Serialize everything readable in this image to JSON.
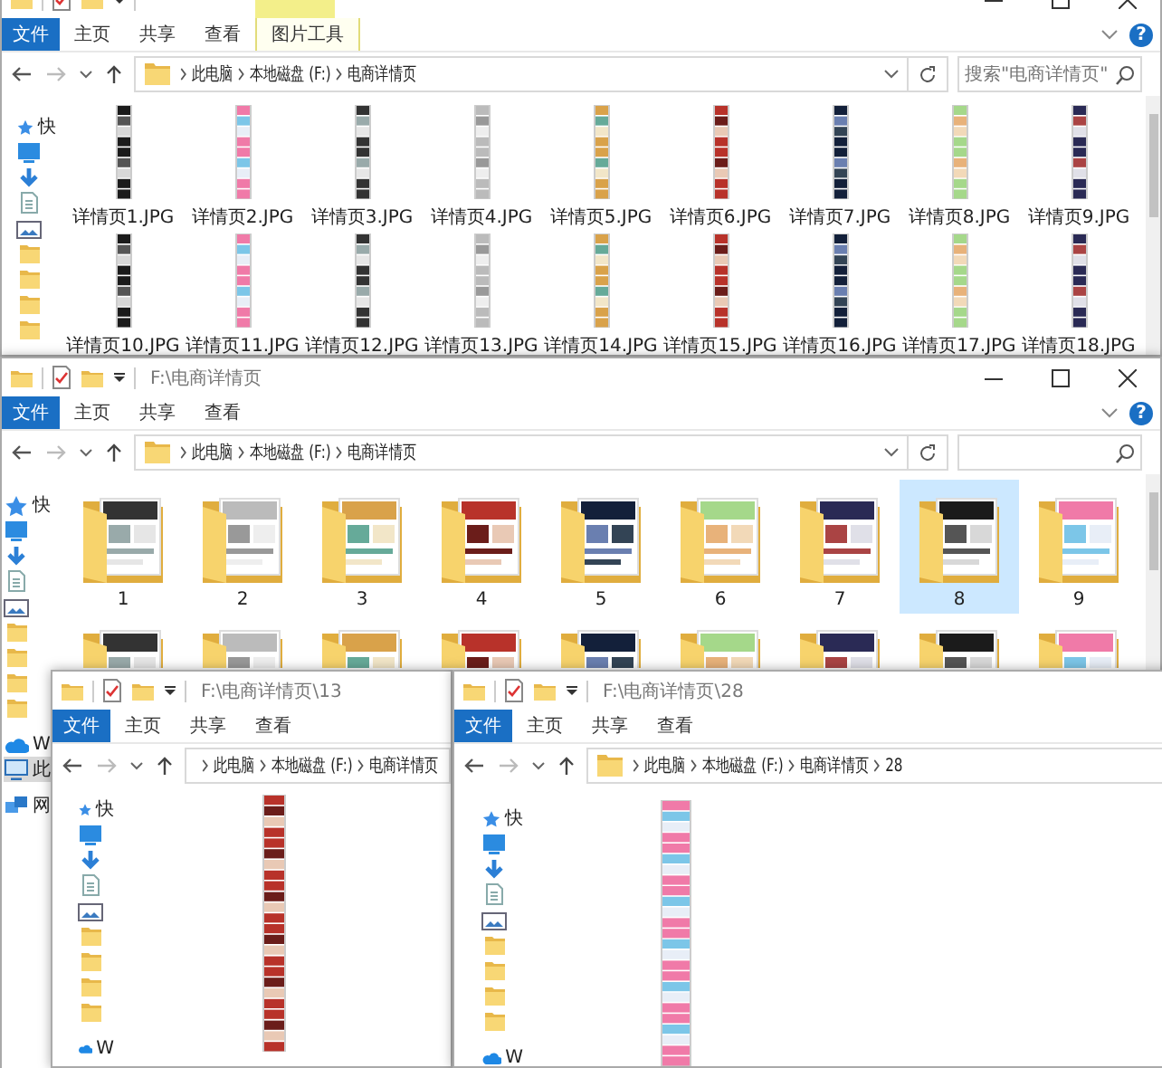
{
  "windows": [
    {
      "context_group": true,
      "ribbon_tabs": [
        {
          "label": "文件",
          "kind": "file"
        },
        {
          "label": "主页",
          "kind": "tab"
        },
        {
          "label": "共享",
          "kind": "tab"
        },
        {
          "label": "查看",
          "kind": "tab"
        },
        {
          "label": "图片工具",
          "kind": "context"
        }
      ],
      "help": "?",
      "breadcrumb": [
        "此电脑",
        "本地磁盘 (F:)",
        "电商详情页"
      ],
      "search": {
        "placeholder": "搜索\"电商详情页\""
      },
      "sidebar": [
        {
          "kind": "quick",
          "label": "快",
          "selected": false
        },
        {
          "kind": "desktop",
          "selected": false
        },
        {
          "kind": "download",
          "selected": false
        },
        {
          "kind": "document",
          "selected": false
        },
        {
          "kind": "picture",
          "selected": false
        },
        {
          "kind": "folder",
          "selected": false
        },
        {
          "kind": "folder",
          "selected": false
        },
        {
          "kind": "folder",
          "selected": false
        },
        {
          "kind": "folder",
          "selected": false
        }
      ],
      "items": [
        {
          "kind": "image",
          "label": "详情页1.JPG",
          "selected": false
        },
        {
          "kind": "image",
          "label": "详情页2.JPG",
          "selected": false
        },
        {
          "kind": "image",
          "label": "详情页3.JPG",
          "selected": false
        },
        {
          "kind": "image",
          "label": "详情页4.JPG",
          "selected": false
        },
        {
          "kind": "image",
          "label": "详情页5.JPG",
          "selected": false
        },
        {
          "kind": "image",
          "label": "详情页6.JPG",
          "selected": false
        },
        {
          "kind": "image",
          "label": "详情页7.JPG",
          "selected": false
        },
        {
          "kind": "image",
          "label": "详情页8.JPG",
          "selected": false
        },
        {
          "kind": "image",
          "label": "详情页9.JPG",
          "selected": false
        },
        {
          "kind": "image",
          "label": "详情页10.JPG",
          "selected": false
        },
        {
          "kind": "image",
          "label": "详情页11.JPG",
          "selected": false
        },
        {
          "kind": "image",
          "label": "详情页12.JPG",
          "selected": false
        },
        {
          "kind": "image",
          "label": "详情页13.JPG",
          "selected": false
        },
        {
          "kind": "image",
          "label": "详情页14.JPG",
          "selected": false
        },
        {
          "kind": "image",
          "label": "详情页15.JPG",
          "selected": false
        },
        {
          "kind": "image",
          "label": "详情页16.JPG",
          "selected": false
        },
        {
          "kind": "image",
          "label": "详情页17.JPG",
          "selected": false
        },
        {
          "kind": "image",
          "label": "详情页18.JPG",
          "selected": false
        }
      ]
    },
    {
      "title": "F:\\电商详情页",
      "ribbon_tabs": [
        {
          "label": "文件",
          "kind": "file"
        },
        {
          "label": "主页",
          "kind": "tab"
        },
        {
          "label": "共享",
          "kind": "tab"
        },
        {
          "label": "查看",
          "kind": "tab"
        }
      ],
      "help": "?",
      "breadcrumb": [
        "此电脑",
        "本地磁盘 (F:)",
        "电商详情页"
      ],
      "sidebar": [
        {
          "kind": "quick",
          "label": "快",
          "selected": false
        },
        {
          "kind": "desktop",
          "selected": false
        },
        {
          "kind": "download",
          "selected": false
        },
        {
          "kind": "document",
          "selected": false
        },
        {
          "kind": "picture",
          "selected": false
        },
        {
          "kind": "folder",
          "selected": false
        },
        {
          "kind": "folder",
          "selected": false
        },
        {
          "kind": "folder",
          "selected": false
        },
        {
          "kind": "folder",
          "selected": false
        },
        {
          "kind": "onedrive",
          "label": "W",
          "selected": false
        },
        {
          "kind": "pc",
          "label": "此",
          "selected": true
        },
        {
          "kind": "network",
          "label": "网",
          "selected": false
        }
      ],
      "items": [
        {
          "kind": "folder",
          "label": "1",
          "selected": false
        },
        {
          "kind": "folder",
          "label": "2",
          "selected": false
        },
        {
          "kind": "folder",
          "label": "3",
          "selected": false
        },
        {
          "kind": "folder",
          "label": "4",
          "selected": false
        },
        {
          "kind": "folder",
          "label": "5",
          "selected": false
        },
        {
          "kind": "folder",
          "label": "6",
          "selected": false
        },
        {
          "kind": "folder",
          "label": "7",
          "selected": false
        },
        {
          "kind": "folder",
          "label": "8",
          "selected": true
        },
        {
          "kind": "folder",
          "label": "9",
          "selected": false
        },
        {
          "kind": "folder",
          "selected": false
        },
        {
          "kind": "folder",
          "selected": false
        },
        {
          "kind": "folder",
          "selected": false
        },
        {
          "kind": "folder",
          "selected": false
        },
        {
          "kind": "folder",
          "selected": false
        },
        {
          "kind": "folder",
          "selected": false
        },
        {
          "kind": "folder",
          "selected": false
        },
        {
          "kind": "folder",
          "selected": false
        },
        {
          "kind": "folder",
          "selected": false
        }
      ]
    },
    {
      "title": "F:\\电商详情页\\13",
      "ribbon_tabs": [
        {
          "label": "文件",
          "kind": "file"
        },
        {
          "label": "主页",
          "kind": "tab"
        },
        {
          "label": "共享",
          "kind": "tab"
        },
        {
          "label": "查看",
          "kind": "tab"
        }
      ],
      "breadcrumb": [
        "此电脑",
        "本地磁盘 (F:)",
        "电商详情页"
      ],
      "sidebar": [
        {
          "kind": "quick",
          "label": "快",
          "selected": false
        },
        {
          "kind": "desktop",
          "selected": false
        },
        {
          "kind": "download",
          "selected": false
        },
        {
          "kind": "document",
          "selected": false
        },
        {
          "kind": "picture",
          "selected": false
        },
        {
          "kind": "folder",
          "selected": false
        },
        {
          "kind": "folder",
          "selected": false
        },
        {
          "kind": "folder",
          "selected": false
        },
        {
          "kind": "folder",
          "selected": false
        },
        {
          "kind": "onedrive",
          "label": "W",
          "selected": false
        }
      ],
      "items": [
        {
          "kind": "image",
          "selected": false
        }
      ]
    },
    {
      "title": "F:\\电商详情页\\28",
      "ribbon_tabs": [
        {
          "label": "文件",
          "kind": "file"
        },
        {
          "label": "主页",
          "kind": "tab"
        },
        {
          "label": "共享",
          "kind": "tab"
        },
        {
          "label": "查看",
          "kind": "tab"
        }
      ],
      "breadcrumb": [
        "此电脑",
        "本地磁盘 (F:)",
        "电商详情页",
        "28"
      ],
      "sidebar": [
        {
          "kind": "quick",
          "label": "快",
          "selected": false
        },
        {
          "kind": "desktop",
          "selected": false
        },
        {
          "kind": "download",
          "selected": false
        },
        {
          "kind": "document",
          "selected": false
        },
        {
          "kind": "picture",
          "selected": false
        },
        {
          "kind": "folder",
          "selected": false
        },
        {
          "kind": "folder",
          "selected": false
        },
        {
          "kind": "folder",
          "selected": false
        },
        {
          "kind": "folder",
          "selected": false
        },
        {
          "kind": "onedrive",
          "label": "W",
          "selected": false
        }
      ],
      "items": [
        {
          "kind": "image",
          "selected": false
        }
      ]
    }
  ]
}
